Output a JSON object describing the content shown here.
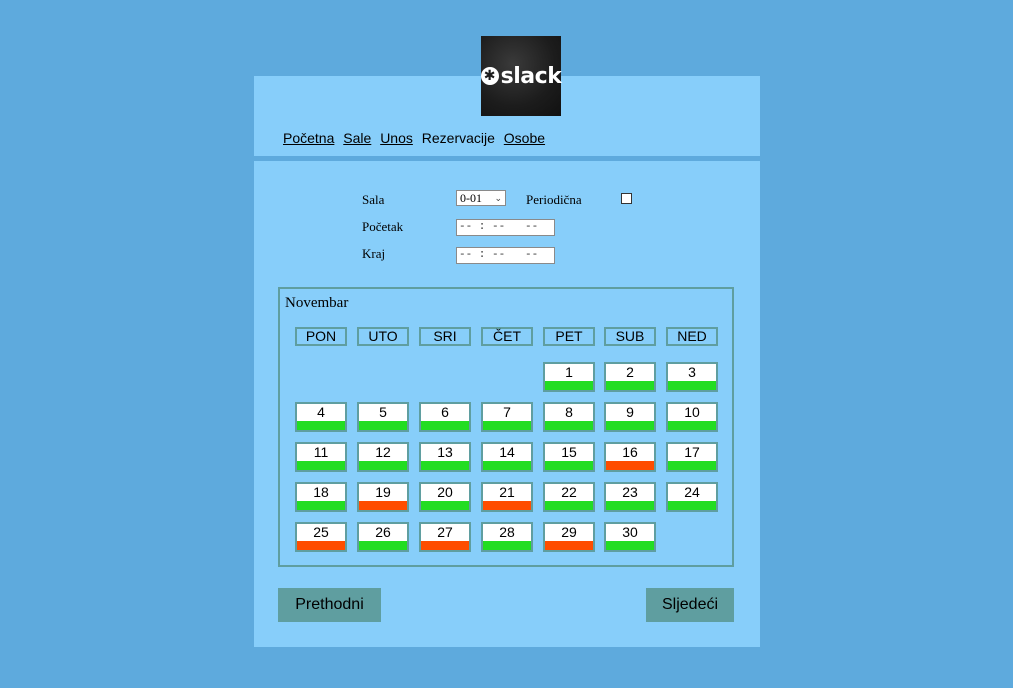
{
  "logo": {
    "text": "slack",
    "mark": "✱"
  },
  "nav": {
    "items": [
      {
        "label": "Početna",
        "link": true
      },
      {
        "label": "Sale",
        "link": true
      },
      {
        "label": "Unos",
        "link": true
      },
      {
        "label": "Rezervacije",
        "link": false
      },
      {
        "label": "Osobe",
        "link": true
      }
    ]
  },
  "form": {
    "sala_label": "Sala",
    "sala_value": "0-01",
    "periodicna_label": "Periodična",
    "periodicna_checked": false,
    "pocetak_label": "Početak",
    "pocetak_value": "-- : --   --",
    "kraj_label": "Kraj",
    "kraj_value": "-- : --   --"
  },
  "calendar": {
    "month": "Novembar",
    "weekdays": [
      "PON",
      "UTO",
      "SRI",
      "ČET",
      "PET",
      "SUB",
      "NED"
    ],
    "first_weekday_index": 4,
    "days": [
      {
        "n": "1",
        "status": "free"
      },
      {
        "n": "2",
        "status": "free"
      },
      {
        "n": "3",
        "status": "free"
      },
      {
        "n": "4",
        "status": "free"
      },
      {
        "n": "5",
        "status": "free"
      },
      {
        "n": "6",
        "status": "free"
      },
      {
        "n": "7",
        "status": "free"
      },
      {
        "n": "8",
        "status": "free"
      },
      {
        "n": "9",
        "status": "free"
      },
      {
        "n": "10",
        "status": "free"
      },
      {
        "n": "11",
        "status": "free"
      },
      {
        "n": "12",
        "status": "free"
      },
      {
        "n": "13",
        "status": "free"
      },
      {
        "n": "14",
        "status": "free"
      },
      {
        "n": "15",
        "status": "free"
      },
      {
        "n": "16",
        "status": "booked"
      },
      {
        "n": "17",
        "status": "free"
      },
      {
        "n": "18",
        "status": "free"
      },
      {
        "n": "19",
        "status": "booked"
      },
      {
        "n": "20",
        "status": "free"
      },
      {
        "n": "21",
        "status": "booked"
      },
      {
        "n": "22",
        "status": "free"
      },
      {
        "n": "23",
        "status": "free"
      },
      {
        "n": "24",
        "status": "free"
      },
      {
        "n": "25",
        "status": "booked"
      },
      {
        "n": "26",
        "status": "free"
      },
      {
        "n": "27",
        "status": "booked"
      },
      {
        "n": "28",
        "status": "free"
      },
      {
        "n": "29",
        "status": "booked"
      },
      {
        "n": "30",
        "status": "free"
      }
    ],
    "colors": {
      "free": "#22dd22",
      "booked": "#ff4d00"
    }
  },
  "buttons": {
    "prev": "Prethodni",
    "next": "Sljedeći"
  }
}
